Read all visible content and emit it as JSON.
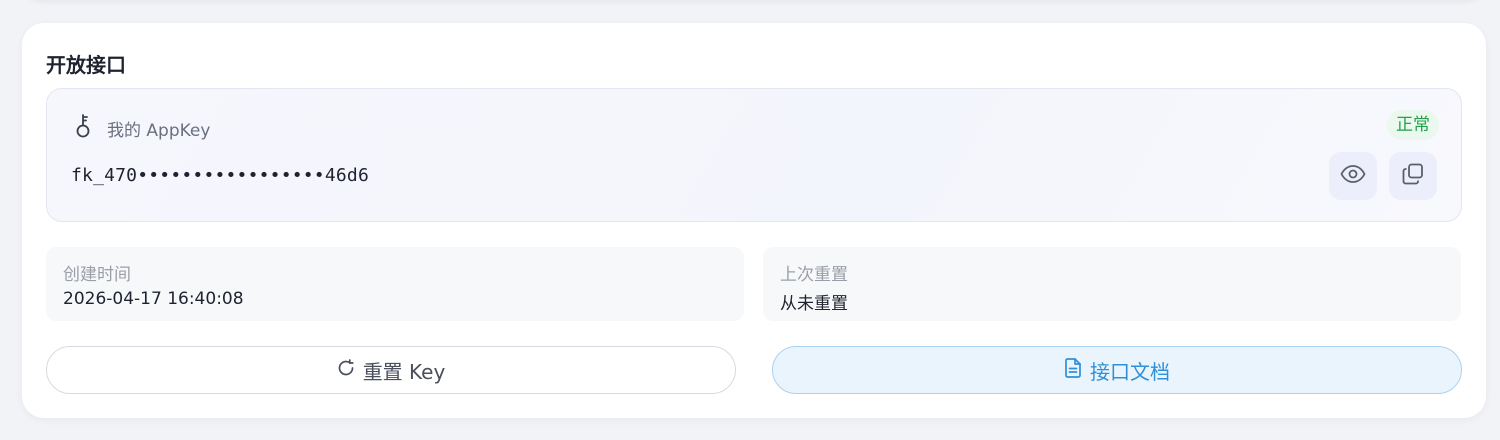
{
  "section": {
    "title": "开放接口"
  },
  "appkey": {
    "label": "我的 AppKey",
    "status": "正常",
    "masked_value": "fk_470•••••••••••••••••46d6",
    "icons": {
      "key": "key-icon",
      "show": "eye-icon",
      "copy": "copy-icon"
    }
  },
  "info": {
    "created_label": "创建时间",
    "created_value": "2026-04-17 16:40:08",
    "reset_label": "上次重置",
    "reset_value": "从未重置"
  },
  "actions": {
    "reset_label": "重置 Key",
    "docs_label": "接口文档"
  },
  "colors": {
    "status_green": "#23a24d",
    "docs_blue": "#2f8fd8"
  }
}
